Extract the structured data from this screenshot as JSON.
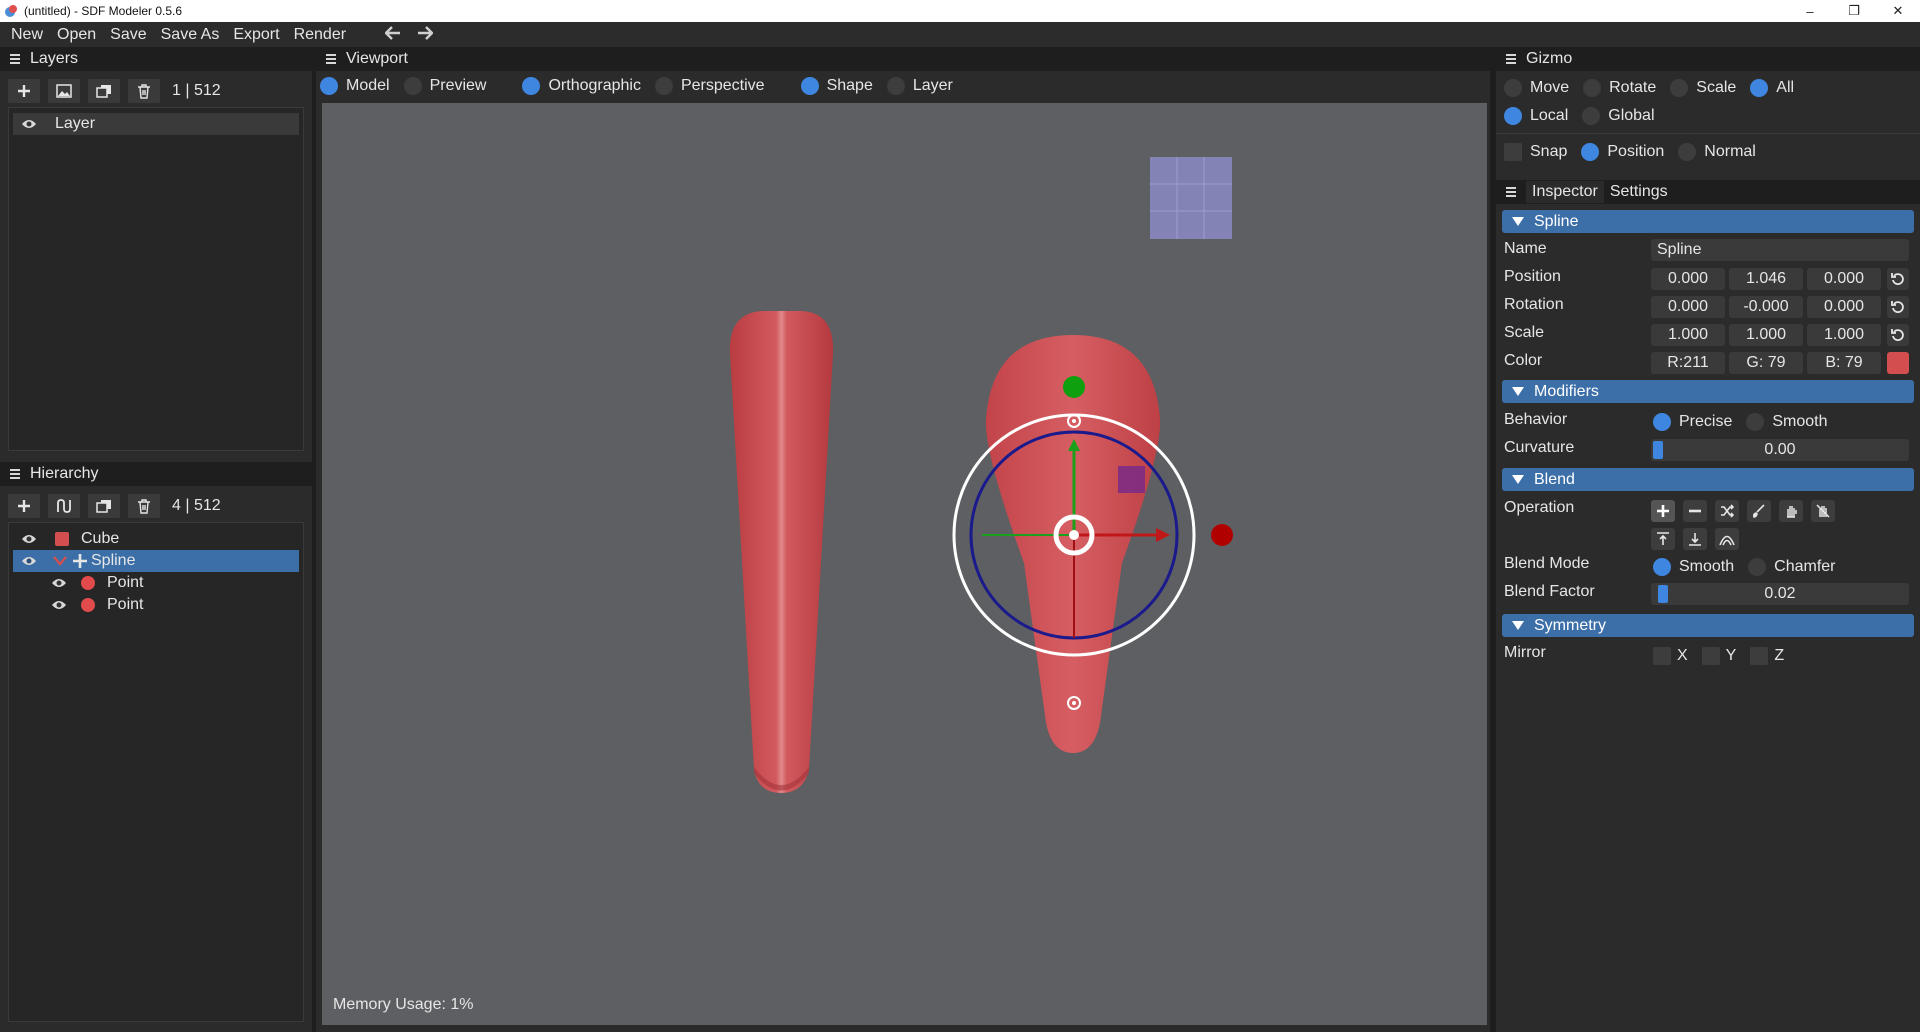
{
  "window": {
    "title": "(untitled) - SDF Modeler 0.5.6",
    "minimize": "–",
    "maximize": "❐",
    "close": "✕"
  },
  "menu": {
    "items": [
      "New",
      "Open",
      "Save",
      "Save As",
      "Export",
      "Render"
    ],
    "back_icon": "arrow-left-icon",
    "forward_icon": "arrow-right-icon"
  },
  "layers": {
    "title": "Layers",
    "count": "1 | 512",
    "toolbar_icons": [
      "plus-icon",
      "image-icon",
      "duplicate-icon",
      "trash-icon"
    ],
    "items": [
      {
        "label": "Layer",
        "visible": true
      }
    ]
  },
  "hierarchy": {
    "title": "Hierarchy",
    "count": "4 | 512",
    "toolbar_icons": [
      "plus-icon",
      "spline-icon",
      "duplicate-icon",
      "trash-icon"
    ],
    "items": [
      {
        "label": "Cube",
        "color": "#d34f4f",
        "kind": "swatch",
        "selected": false
      },
      {
        "label": "Spline",
        "color": "#d34f4f",
        "kind": "spline",
        "selected": true
      },
      {
        "label": "Point",
        "color": "#e24b4b",
        "kind": "dot",
        "selected": false
      },
      {
        "label": "Point",
        "color": "#e24b4b",
        "kind": "dot",
        "selected": false
      }
    ]
  },
  "viewport": {
    "title": "Viewport",
    "mode_options": [
      {
        "label": "Model",
        "on": true
      },
      {
        "label": "Preview",
        "on": false
      }
    ],
    "projection_options": [
      {
        "label": "Orthographic",
        "on": true
      },
      {
        "label": "Perspective",
        "on": false
      }
    ],
    "pick_options": [
      {
        "label": "Shape",
        "on": true
      },
      {
        "label": "Layer",
        "on": false
      }
    ],
    "memory_usage": "Memory Usage: 1%"
  },
  "gizmo": {
    "title": "Gizmo",
    "transform_options": [
      {
        "label": "Move",
        "on": false
      },
      {
        "label": "Rotate",
        "on": false
      },
      {
        "label": "Scale",
        "on": false
      },
      {
        "label": "All",
        "on": true
      }
    ],
    "space_options": [
      {
        "label": "Local",
        "on": true
      },
      {
        "label": "Global",
        "on": false
      }
    ],
    "snap_options": [
      {
        "label": "Snap",
        "on": false
      },
      {
        "label": "Position",
        "on": true
      },
      {
        "label": "Normal",
        "on": false
      }
    ]
  },
  "inspector": {
    "tabs": [
      "Inspector",
      "Settings"
    ],
    "spline": {
      "section": "Spline",
      "name_label": "Name",
      "name_value": "Spline",
      "position_label": "Position",
      "position": [
        "0.000",
        "1.046",
        "0.000"
      ],
      "rotation_label": "Rotation",
      "rotation": [
        "0.000",
        "-0.000",
        "0.000"
      ],
      "scale_label": "Scale",
      "scale": [
        "1.000",
        "1.000",
        "1.000"
      ],
      "color_label": "Color",
      "color": [
        "R:211",
        "G: 79",
        "B: 79"
      ],
      "color_hex": "#d34f4f"
    },
    "modifiers": {
      "section": "Modifiers",
      "behavior_label": "Behavior",
      "behavior_options": [
        {
          "label": "Precise",
          "on": true
        },
        {
          "label": "Smooth",
          "on": false
        }
      ],
      "curvature_label": "Curvature",
      "curvature_value": "0.00"
    },
    "blend": {
      "section": "Blend",
      "operation_label": "Operation",
      "operation_icons": [
        "union-icon",
        "subtract-icon",
        "shuffle-icon",
        "paint-icon",
        "hand-icon",
        "hand-cross-icon",
        "align-top-icon",
        "align-bottom-icon",
        "smooth-arc-icon"
      ],
      "blend_mode_label": "Blend Mode",
      "blend_mode_options": [
        {
          "label": "Smooth",
          "on": true
        },
        {
          "label": "Chamfer",
          "on": false
        }
      ],
      "blend_factor_label": "Blend Factor",
      "blend_factor_value": "0.02"
    },
    "symmetry": {
      "section": "Symmetry",
      "mirror_label": "Mirror",
      "axes": [
        "X",
        "Y",
        "Z"
      ]
    }
  },
  "colors": {
    "accent": "#3c6ea8",
    "radio_on": "#3f86e0",
    "shape_red": "#c9474b",
    "gizmo_ring": "#1a1a8c"
  }
}
